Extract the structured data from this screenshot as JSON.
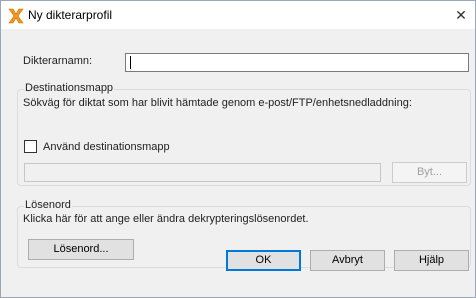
{
  "window": {
    "title": "Ny dikterarprofil",
    "close_symbol": "✕",
    "icon": "app-x-logo-icon"
  },
  "name_field": {
    "label": "Dikterarnamn:",
    "value": ""
  },
  "destination_group": {
    "title": "Destinationsmapp",
    "description": "Sökväg för diktat som har blivit hämtade genom e-post/FTP/enhetsnedladdning:",
    "checkbox_label": "Använd destinationsmapp",
    "checkbox_checked": false,
    "path_value": "",
    "browse_label": "Byt..."
  },
  "password_group": {
    "title": "Lösenord",
    "description": "Klicka här för att ange eller ändra dekrypteringslösenordet.",
    "button_label": "Lösenord..."
  },
  "footer": {
    "ok_label": "OK",
    "cancel_label": "Avbryt",
    "help_label": "Hjälp"
  },
  "colors": {
    "accent": "#0078d7",
    "icon_orange": "#f39a1e"
  }
}
